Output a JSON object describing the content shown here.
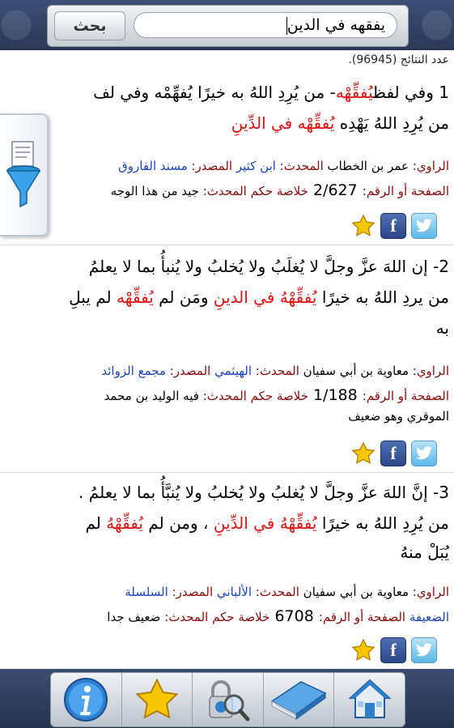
{
  "search": {
    "button_label": "بحث",
    "query": "يفقهه في الدين"
  },
  "results": {
    "count_text": "عدد النتائج (96945)."
  },
  "cards": [
    {
      "line1": [
        "1 وفي لفظ",
        "يُفقِّهْه",
        "- من يُرِدِ اللهُ به خيرًا يُفهِّمْه وفي لف"
      ],
      "line2": [
        "من يُرِدِ اللهُ يَهْدِه ",
        "يُفقِّهْه في الدِّينِ"
      ],
      "narrator_label": "الراوي:",
      "narrator": " عمر بن الخطاب ",
      "muhaddith_label": "المحدث:",
      "muhaddith": " ابن كثير ",
      "source_label": "المصدر:",
      "source": " مسند الفاروق",
      "page_label": "الصفحة أو الرقم:",
      "page": " 2/627 ",
      "ruling_label": "خلاصة حكم المحدث:",
      "ruling": " جيد من هذا الوجه"
    },
    {
      "line1": [
        "2- إن اللهَ عزَّ وجلَّ لا يُغلَبُ ولا يُخلبُ ولا يُنبأُ بما لا يعلمُ"
      ],
      "line2": [
        "من يردِ اللهُ به خيرًا ",
        "يُفقِّهْهُ في الدينِ",
        " ومَن لم ",
        "يُفقِّهْه",
        " لم يبلِ"
      ],
      "line3": "به",
      "narrator_label": "الراوي:",
      "narrator": " معاوية بن أبي سفيان ",
      "muhaddith_label": "المحدث:",
      "muhaddith": " الهيثمي ",
      "source_label": "المصدر:",
      "source": " مجمع الزوائد",
      "page_label": "الصفحة أو الرقم:",
      "page": " 1/188 ",
      "ruling_label": "خلاصة حكم المحدث:",
      "ruling": " فيه الوليد بن محمد",
      "ruling_cont": "الموقري وهو ضعيف"
    },
    {
      "line1": [
        "3- إنَّ اللهَ عزَّ وجلَّ لا يُغلبُ ولا يُخلبُ ولا يُنبَّأُ بما لا يعلمُ ."
      ],
      "line2": [
        "من يُرِدِ اللهُ به خيرًا ",
        "يُفقِّهْهُ في الدِّينِ",
        " ، ومن لم ",
        "يُفقِّهْهُ",
        " لم"
      ],
      "line3": "يُبَلْ منهُ",
      "narrator_label": "الراوي:",
      "narrator": " معاوية بن أبي سفيان ",
      "muhaddith_label": "المحدث:",
      "muhaddith": " الألباني ",
      "source_label": "المصدر:",
      "source": " السلسلة",
      "source_cont": "الضعيفة",
      "page_label": " الصفحة أو الرقم:",
      "page": " 6708 ",
      "ruling_label": "خلاصة حكم المحدث:",
      "ruling": " ضعيف جدا"
    }
  ],
  "toolbar": [
    "info-icon",
    "star-icon",
    "search-lock-icon",
    "book-icon",
    "home-icon"
  ]
}
